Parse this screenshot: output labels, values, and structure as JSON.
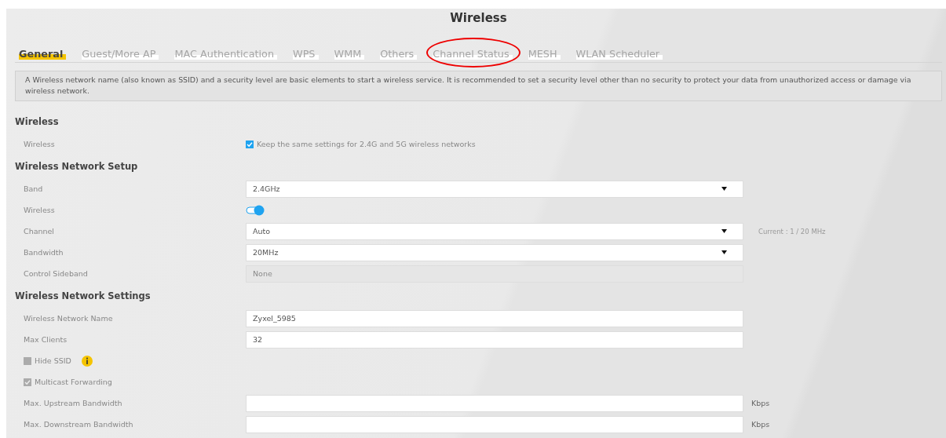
{
  "page_title": "Wireless",
  "tabs": [
    {
      "label": "General",
      "selected": true,
      "circled": false
    },
    {
      "label": "Guest/More AP",
      "selected": false,
      "circled": false
    },
    {
      "label": "MAC Authentication",
      "selected": false,
      "circled": false
    },
    {
      "label": "WPS",
      "selected": false,
      "circled": false
    },
    {
      "label": "WMM",
      "selected": false,
      "circled": false
    },
    {
      "label": "Others",
      "selected": false,
      "circled": false
    },
    {
      "label": "Channel Status",
      "selected": false,
      "circled": true
    },
    {
      "label": "MESH",
      "selected": false,
      "circled": false
    },
    {
      "label": "WLAN Scheduler",
      "selected": false,
      "circled": false
    }
  ],
  "info_text": "A Wireless network name (also known as SSID) and a security level are basic elements to start a wireless service. It is recommended to set a security level other than no security to protect your data from unauthorized access or damage via wireless network.",
  "sections": [
    {
      "title": "Wireless",
      "rows": [
        {
          "kind": "checkbox_field",
          "label": "Wireless",
          "checked": true,
          "text": "Keep the same settings for 2.4G and 5G wireless networks"
        }
      ]
    },
    {
      "title": "Wireless Network Setup",
      "rows": [
        {
          "kind": "select",
          "label": "Band",
          "value": "2.4GHz"
        },
        {
          "kind": "toggle",
          "label": "Wireless",
          "on": true
        },
        {
          "kind": "select",
          "label": "Channel",
          "value": "Auto",
          "note": "Current : 1 / 20 MHz"
        },
        {
          "kind": "select",
          "label": "Bandwidth",
          "value": "20MHz"
        },
        {
          "kind": "disabled",
          "label": "Control Sideband",
          "value": "None"
        }
      ]
    },
    {
      "title": "Wireless Network Settings",
      "rows": [
        {
          "kind": "text",
          "label": "Wireless Network Name",
          "value": "Zyxel_5985"
        },
        {
          "kind": "text",
          "label": "Max Clients",
          "value": "32"
        },
        {
          "kind": "checkbox",
          "label": "Hide SSID",
          "checked": false,
          "info": true
        },
        {
          "kind": "checkbox",
          "label": "Multicast Forwarding",
          "checked": true
        },
        {
          "kind": "text",
          "label": "Max. Upstream Bandwidth",
          "unit": "Kbps"
        },
        {
          "kind": "text",
          "label": "Max. Downstream Bandwidth",
          "unit": "Kbps"
        }
      ]
    }
  ]
}
